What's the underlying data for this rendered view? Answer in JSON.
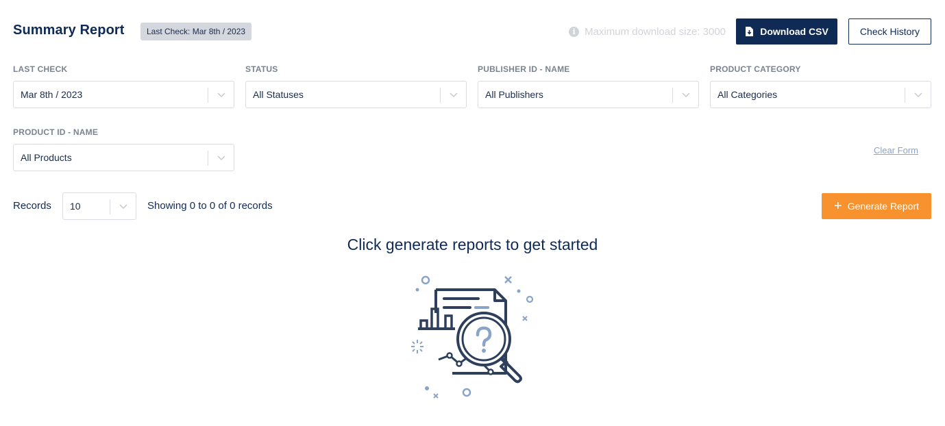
{
  "header": {
    "title": "Summary Report",
    "badge": "Last Check: Mar 8th / 2023",
    "max_download": "Maximum download size: 3000",
    "download_csv_label": "Download CSV",
    "check_history_label": "Check History"
  },
  "filters": {
    "last_check": {
      "label": "LAST CHECK",
      "value": "Mar 8th / 2023"
    },
    "status": {
      "label": "STATUS",
      "value": "All Statuses"
    },
    "publisher": {
      "label": "PUBLISHER ID - NAME",
      "value": "All Publishers"
    },
    "category": {
      "label": "PRODUCT CATEGORY",
      "value": "All Categories"
    },
    "product": {
      "label": "PRODUCT ID - NAME",
      "value": "All Products"
    },
    "clear_form_label": "Clear Form"
  },
  "records": {
    "label": "Records",
    "page_size": "10",
    "showing": "Showing 0 to 0 of 0 records",
    "generate_label": "Generate Report"
  },
  "empty_state": {
    "title": "Click generate reports to get started",
    "icon": "report-search-illustration"
  },
  "colors": {
    "primary": "#0f2a55",
    "accent": "#f7922e",
    "illustration_line": "#2e3f5c",
    "illustration_accent": "#8aa4c8"
  }
}
